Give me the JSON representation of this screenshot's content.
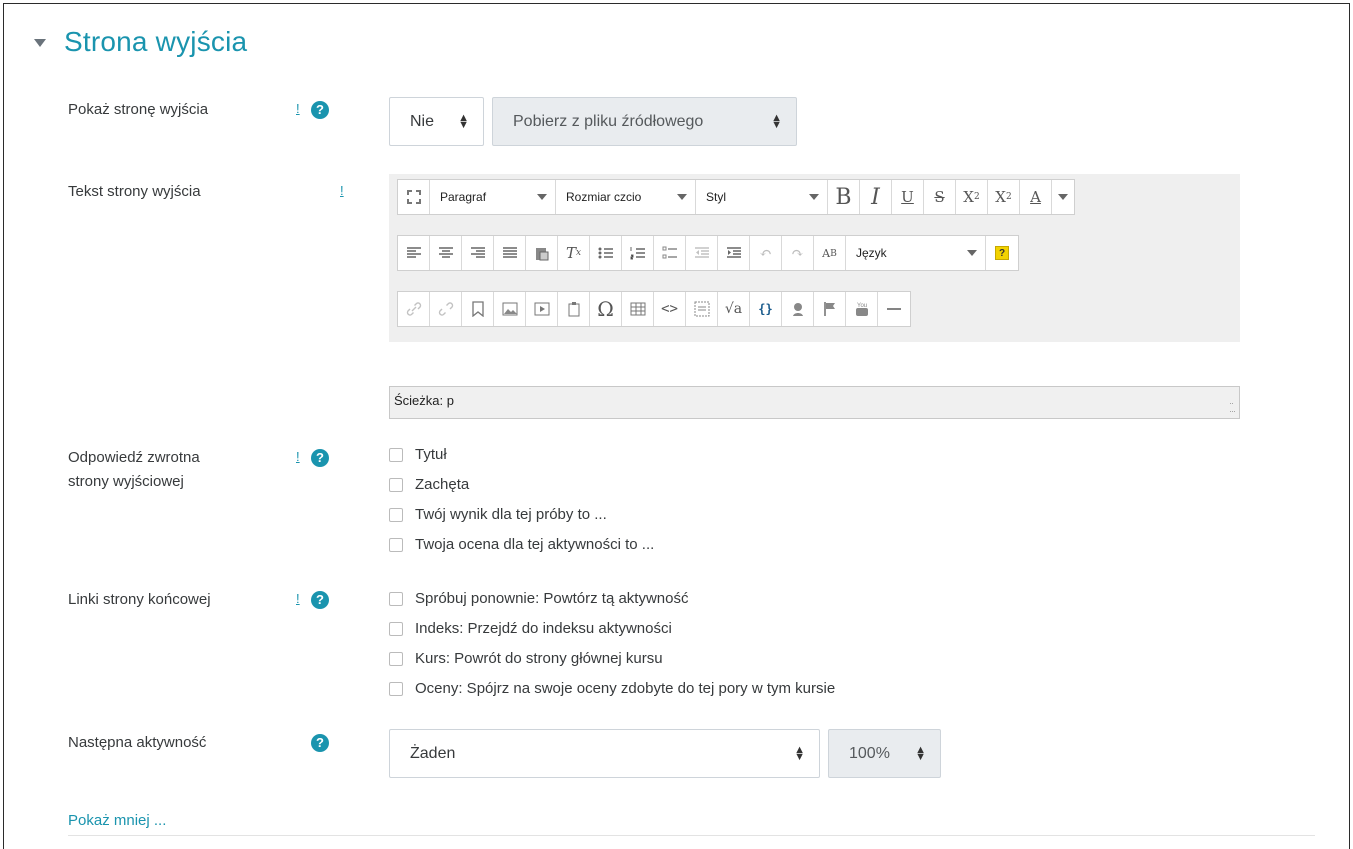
{
  "section": {
    "title": "Strona wyjścia"
  },
  "show_end_page": {
    "label": "Pokaż stronę wyjścia",
    "flag": "!",
    "help": "?",
    "value": "Nie",
    "disabled_select": "Pobierz z pliku źródłowego"
  },
  "end_page_text": {
    "label": "Tekst strony wyjścia",
    "flag": "!",
    "toolbar": {
      "paragraph": "Paragraf",
      "font_size": "Rozmiar czcio",
      "style": "Styl",
      "language": "Język"
    },
    "path": "Ścieżka: p"
  },
  "feedback": {
    "label_line1": "Odpowiedź zwrotna",
    "label_line2": "strony wyjściowej",
    "flag": "!",
    "help": "?",
    "options": [
      "Tytuł",
      "Zachęta",
      "Twój wynik dla tej próby to ...",
      "Twoja ocena dla tej aktywności to ..."
    ]
  },
  "end_links": {
    "label": "Linki strony końcowej",
    "flag": "!",
    "help": "?",
    "options": [
      "Spróbuj ponownie: Powtórz tą aktywność",
      "Indeks: Przejdź do indeksu aktywności",
      "Kurs: Powrót do strony głównej kursu",
      "Oceny: Spójrz na swoje oceny zdobyte do tej pory w tym kursie"
    ]
  },
  "next_activity": {
    "label": "Następna aktywność",
    "help": "?",
    "value": "Żaden",
    "percent": "100%"
  },
  "show_less": "Pokaż mniej ..."
}
